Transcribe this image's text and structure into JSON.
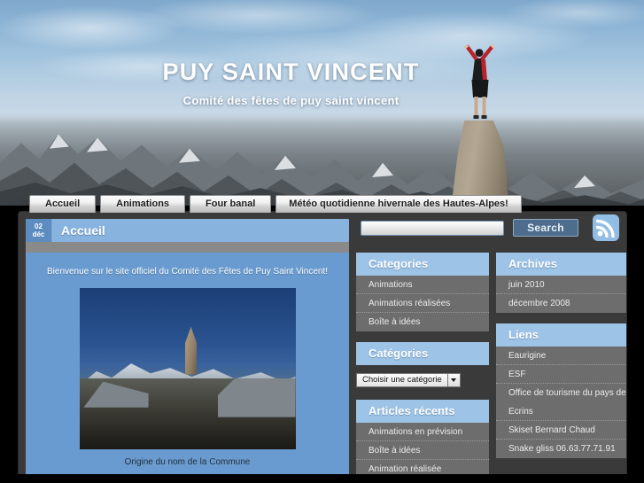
{
  "hero": {
    "title": "PUY SAINT VINCENT",
    "subtitle": "Comité des fêtes de puy saint vincent"
  },
  "nav": {
    "items": [
      {
        "label": "Accueil"
      },
      {
        "label": "Animations"
      },
      {
        "label": "Four banal"
      },
      {
        "label": "Météo quotidienne hivernale des Hautes-Alpes!"
      }
    ]
  },
  "post": {
    "date_day": "02",
    "date_month": "déc",
    "title": "Accueil",
    "welcome": "Bienvenue sur le site officiel du Comité des Fêtes de Puy Saint Vincent!",
    "caption": "Origine du nom de la Commune"
  },
  "search": {
    "value": "",
    "placeholder": "",
    "button_label": "Search"
  },
  "rss": {
    "icon": "rss-feed-icon"
  },
  "sidebar_left": {
    "widgets": [
      {
        "title": "Categories",
        "type": "list",
        "items": [
          "Animations",
          "Animations réalisées",
          "Boîte à idées"
        ]
      },
      {
        "title": "Catégories",
        "type": "select",
        "select_label": "Choisir une catégorie"
      },
      {
        "title": "Articles récents",
        "type": "list",
        "items": [
          "Animations en prévision",
          "Boîte à idées",
          "Animation réalisée"
        ]
      }
    ]
  },
  "sidebar_right": {
    "widgets": [
      {
        "title": "Archives",
        "type": "list",
        "items": [
          "juin 2010",
          "décembre 2008"
        ]
      },
      {
        "title": "Liens",
        "type": "list",
        "items": [
          "Eaurigine",
          "ESF",
          "Office de tourisme du pays des Ecrins",
          "Skiset Bernard Chaud",
          "Snake gliss 06.63.77.71.91"
        ]
      }
    ]
  },
  "colors": {
    "accent_blue": "#9dc3e6",
    "title_bar_blue": "#87b3de",
    "article_blue": "#6a9bd0",
    "panel_dark": "#3a3a3a",
    "list_grey": "#6d6d6d",
    "search_btn": "#4e6d8c",
    "date_badge": "#5d8cc0"
  }
}
